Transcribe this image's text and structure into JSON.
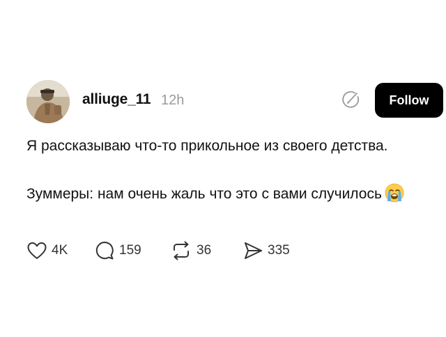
{
  "post": {
    "author": {
      "username": "alliuge_11",
      "time": "12h",
      "avatar_icon": "avatar-photo"
    },
    "follow_label": "Follow",
    "text_lines": [
      "Я рассказываю что-то прикольное из своего детства.",
      "Зуммеры: нам очень жаль что это с вами случилось"
    ],
    "emoji_icon": "loudly-crying-face-icon",
    "actions": {
      "likes": "4K",
      "comments": "159",
      "reposts": "36",
      "shares": "335"
    }
  },
  "colors": {
    "follow_bg": "#000000",
    "time_text": "#9a9a9a",
    "icon_stroke": "#333333"
  }
}
